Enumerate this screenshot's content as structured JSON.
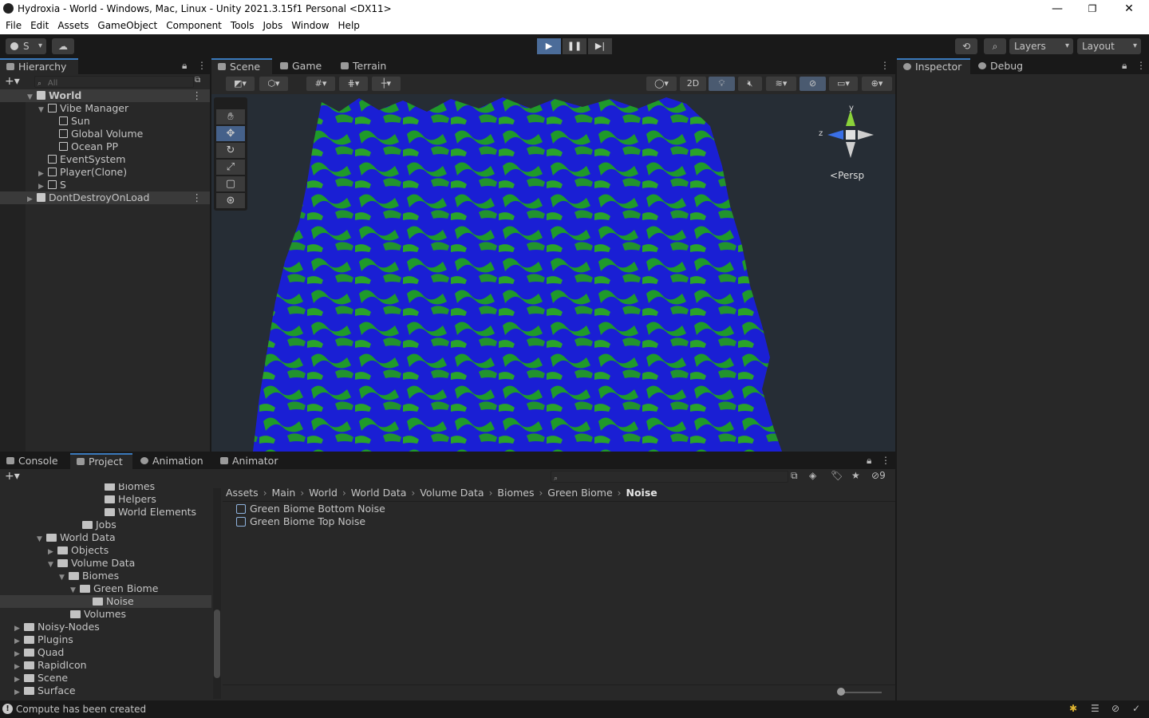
{
  "window": {
    "title": "Hydroxia - World - Windows, Mac, Linux - Unity 2021.3.15f1 Personal <DX11>",
    "minimize": "—",
    "restore": "❐",
    "close": "✕"
  },
  "menu": [
    "File",
    "Edit",
    "Assets",
    "GameObject",
    "Component",
    "Tools",
    "Jobs",
    "Window",
    "Help"
  ],
  "toolbar": {
    "account_label": "S",
    "layers_label": "Layers",
    "layout_label": "Layout"
  },
  "hierarchy": {
    "tab_label": "Hierarchy",
    "search_placeholder": "All",
    "items": [
      {
        "label": "World"
      },
      {
        "label": "Vibe Manager"
      },
      {
        "label": "Sun"
      },
      {
        "label": "Global Volume"
      },
      {
        "label": "Ocean PP"
      },
      {
        "label": "EventSystem"
      },
      {
        "label": "Player(Clone)"
      },
      {
        "label": "S"
      },
      {
        "label": "DontDestroyOnLoad"
      }
    ]
  },
  "scene_tabs": [
    "Scene",
    "Game",
    "Terrain"
  ],
  "scene": {
    "toggle_2d": "2D",
    "persp_label": "Persp",
    "gizmo_y": "y",
    "gizmo_z": "z"
  },
  "inspector_tabs": [
    "Inspector",
    "Debug"
  ],
  "bottom_tabs": [
    "Console",
    "Project",
    "Animation",
    "Animator"
  ],
  "project": {
    "filter_count": "9",
    "tree": [
      {
        "label": "Biomes"
      },
      {
        "label": "Helpers"
      },
      {
        "label": "World Elements"
      },
      {
        "label": "Jobs"
      },
      {
        "label": "World Data"
      },
      {
        "label": "Objects"
      },
      {
        "label": "Volume Data"
      },
      {
        "label": "Biomes"
      },
      {
        "label": "Green Biome"
      },
      {
        "label": "Noise"
      },
      {
        "label": "Volumes"
      },
      {
        "label": "Noisy-Nodes"
      },
      {
        "label": "Plugins"
      },
      {
        "label": "Quad"
      },
      {
        "label": "RapidIcon"
      },
      {
        "label": "Scene"
      },
      {
        "label": "Surface"
      }
    ],
    "breadcrumb": [
      "Assets",
      "Main",
      "World",
      "World Data",
      "Volume Data",
      "Biomes",
      "Green Biome",
      "Noise"
    ],
    "assets": [
      {
        "label": "Green Biome Bottom Noise"
      },
      {
        "label": "Green Biome Top Noise"
      }
    ]
  },
  "status": {
    "message": "Compute has been created"
  }
}
